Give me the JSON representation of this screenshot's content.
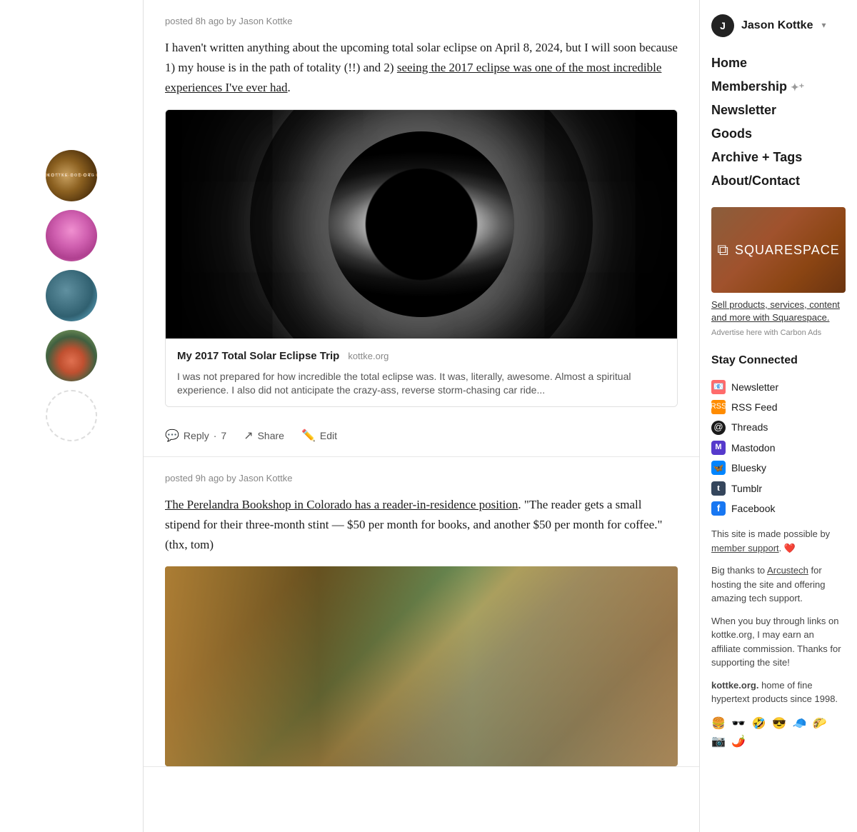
{
  "site": {
    "title": "kottke.org"
  },
  "user": {
    "name": "Jason Kottke",
    "initial": "J"
  },
  "nav": {
    "items": [
      {
        "label": "Home",
        "id": "home"
      },
      {
        "label": "Membership",
        "id": "membership",
        "icon": "✦⁺"
      },
      {
        "label": "Newsletter",
        "id": "newsletter"
      },
      {
        "label": "Goods",
        "id": "goods"
      },
      {
        "label": "Archive + Tags",
        "id": "archive"
      },
      {
        "label": "About/Contact",
        "id": "about"
      }
    ]
  },
  "posts": [
    {
      "id": "post1",
      "meta": "posted 8h ago by Jason Kottke",
      "text": "I haven't written anything about the upcoming total solar eclipse on April 8, 2024, but I will soon because 1) my house is in the path of totality (!!) and 2) seeing the 2017 eclipse was one of the most incredible experiences I've ever had.",
      "text_link_text": "seeing the 2017 eclipse was one of the most incredible experiences I've ever had",
      "link_preview": {
        "title": "My 2017 Total Solar Eclipse Trip",
        "source": "kottke.org",
        "description": "I was not prepared for how incredible the total eclipse was. It was, literally, awesome. Almost a spiritual experience. I also did not anticipate the crazy-ass, reverse storm-chasing car ride..."
      },
      "actions": {
        "reply": "Reply",
        "reply_count": "7",
        "share": "Share",
        "edit": "Edit"
      }
    },
    {
      "id": "post2",
      "meta": "posted 9h ago by Jason Kottke",
      "text_prefix": "",
      "link_text": "The Perelandra Bookshop in Colorado has a reader-in-residence position",
      "text_suffix": ". \"The reader gets a small stipend for their three-month stint — $50 per month for books, and another $50 per month for coffee.\" (thx, tom)"
    }
  ],
  "ad": {
    "brand": "SQUARESPACE",
    "tagline": "Sell products, services, content and more with Squarespace.",
    "advertise_text": "Advertise here with",
    "advertise_link": "Carbon Ads"
  },
  "stay_connected": {
    "title": "Stay Connected",
    "items": [
      {
        "label": "Newsletter",
        "icon_type": "newsletter",
        "icon": "📰"
      },
      {
        "label": "RSS Feed",
        "icon_type": "rss",
        "icon": "📡"
      },
      {
        "label": "Threads",
        "icon_type": "threads",
        "icon": "@"
      },
      {
        "label": "Mastodon",
        "icon_type": "mastodon",
        "icon": "M"
      },
      {
        "label": "Bluesky",
        "icon_type": "bluesky",
        "icon": "🦋"
      },
      {
        "label": "Tumblr",
        "icon_type": "tumblr",
        "icon": "t"
      },
      {
        "label": "Facebook",
        "icon_type": "facebook",
        "icon": "f"
      }
    ]
  },
  "footer_texts": [
    "This site is made possible by member support. ❤️",
    "Big thanks to Arcustech for hosting the site and offering amazing tech support.",
    "When you buy through links on kottke.org, I may earn an affiliate commission. Thanks for supporting the site!",
    "kottke.org. home of fine hypertext products since 1998."
  ],
  "emojis": "🍔 🕶️ 🤣 😎 🧢 🌮 📷 🌶️",
  "avatars": [
    {
      "id": "kottke",
      "type": "kottke",
      "label": "kottke.org logo"
    },
    {
      "id": "pink",
      "type": "pink",
      "label": "pink avatar"
    },
    {
      "id": "teal",
      "type": "teal",
      "label": "teal avatar"
    },
    {
      "id": "orange",
      "type": "orange",
      "label": "orange avatar"
    },
    {
      "id": "empty",
      "type": "empty",
      "label": "empty avatar"
    }
  ]
}
